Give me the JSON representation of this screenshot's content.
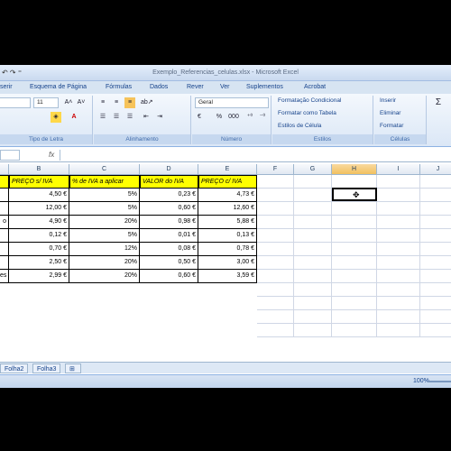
{
  "window": {
    "title": "Exemplo_Referencias_celulas.xlsx - Microsoft Excel",
    "qat": "↶ ↷ ⁼"
  },
  "tabs": [
    "serir",
    "Esquema de Página",
    "Fórmulas",
    "Dados",
    "Rever",
    "Ver",
    "Suplementos",
    "Acrobat"
  ],
  "ribbon": {
    "font_size": "11",
    "number_format": "Geral",
    "group_labels": {
      "font": "Tipo de Letra",
      "alignment": "Alinhamento",
      "number": "Número",
      "styles": "Estilos",
      "cells": "Células"
    },
    "styles_items": [
      "Formatação Condicional",
      "Formatar como Tabela",
      "Estilos de Célula"
    ],
    "cells_items": [
      "Inserir",
      "Eliminar",
      "Formatar"
    ],
    "number_symbols": [
      "%",
      "000",
      "€"
    ],
    "sum_symbol": "Σ"
  },
  "formula_bar": {
    "fx": "fx",
    "value": ""
  },
  "columns": [
    "B",
    "C",
    "D",
    "E",
    "F",
    "G",
    "H",
    "I",
    "J"
  ],
  "selected_column": "H",
  "table": {
    "headers": [
      "PREÇO s/ IVA",
      "% de IVA a aplicar",
      "VALOR do IVA",
      "PREÇO c/ IVA"
    ],
    "row_labels": [
      "",
      "",
      "o",
      "",
      "",
      "",
      "es"
    ],
    "rows": [
      [
        "4,50 €",
        "5%",
        "0,23 €",
        "4,73 €"
      ],
      [
        "12,00 €",
        "5%",
        "0,60 €",
        "12,60 €"
      ],
      [
        "4,90 €",
        "20%",
        "0,98 €",
        "5,88 €"
      ],
      [
        "0,12 €",
        "5%",
        "0,01 €",
        "0,13 €"
      ],
      [
        "0,70 €",
        "12%",
        "0,08 €",
        "0,78 €"
      ],
      [
        "2,50 €",
        "20%",
        "0,50 €",
        "3,00 €"
      ],
      [
        "2,99 €",
        "20%",
        "0,60 €",
        "3,59 €"
      ]
    ]
  },
  "sheets": [
    "Folha2",
    "Folha3"
  ],
  "status": {
    "zoom": "100%"
  }
}
